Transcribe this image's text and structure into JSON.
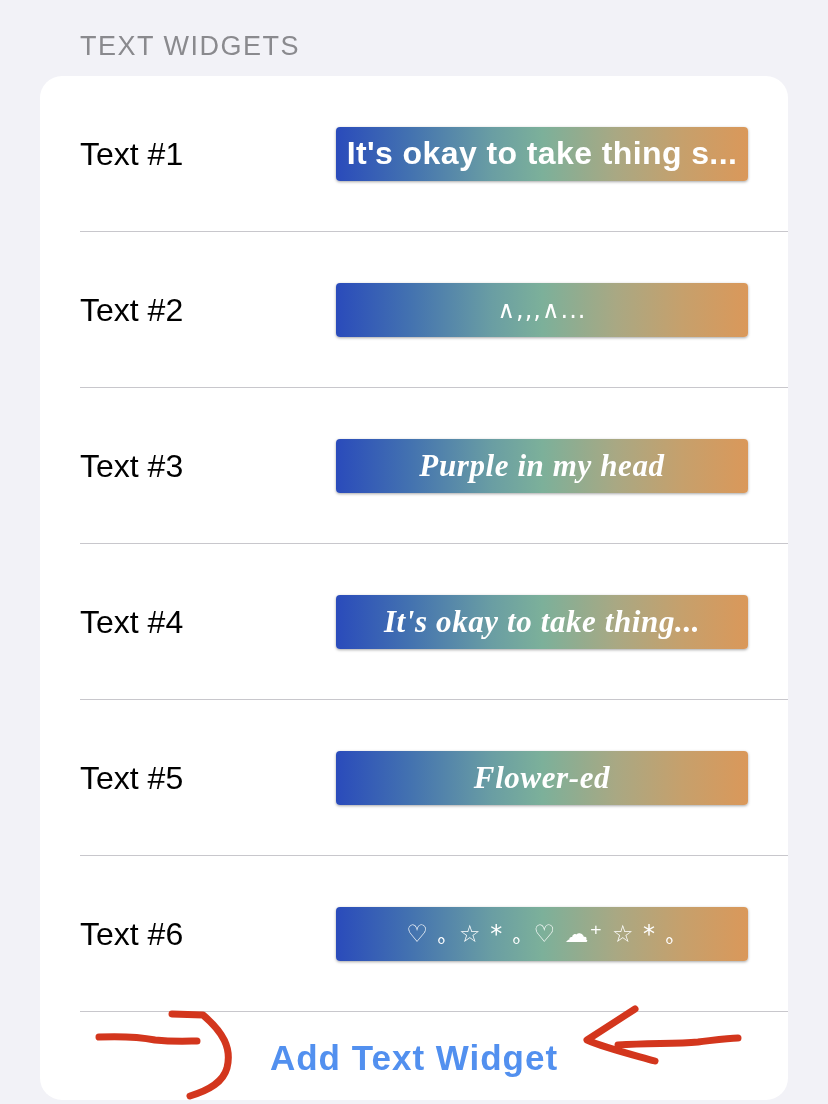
{
  "section": {
    "title": "TEXT WIDGETS"
  },
  "widgets": [
    {
      "label": "Text #1",
      "preview": "It's okay to take thing s...",
      "kind": "bold"
    },
    {
      "label": "Text #2",
      "preview": "∧,,,∧...",
      "kind": "plain"
    },
    {
      "label": "Text #3",
      "preview": "Purple in my head",
      "kind": "serif"
    },
    {
      "label": "Text #4",
      "preview": "It's okay to take thing...",
      "kind": "serif"
    },
    {
      "label": "Text #5",
      "preview": "Flower-ed",
      "kind": "serif"
    },
    {
      "label": "Text #6",
      "preview": "♡ ｡ ☆ * ｡ ♡ ☁⁺ ☆ * ｡",
      "kind": "plain"
    }
  ],
  "add_button": {
    "label": "Add Text Widget"
  }
}
